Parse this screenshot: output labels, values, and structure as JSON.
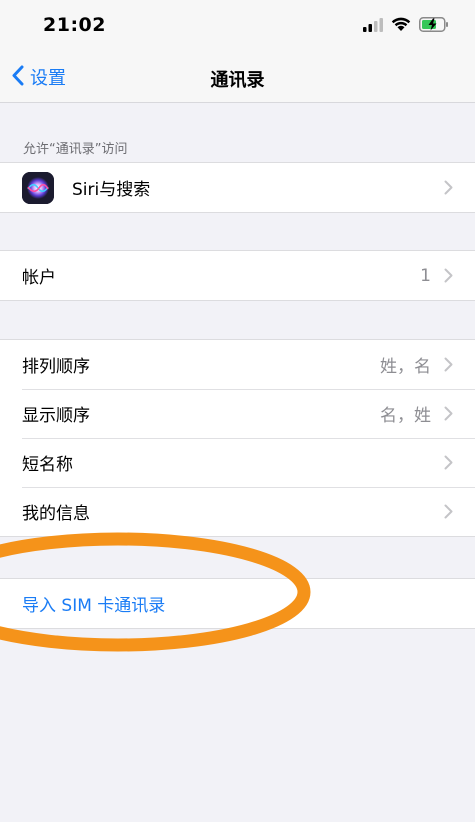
{
  "status_bar": {
    "time": "21:02",
    "battery_color": "#34c759"
  },
  "nav": {
    "back_label": "设置",
    "title": "通讯录"
  },
  "section": {
    "header": "允许“通讯录”访问"
  },
  "groups": {
    "siri": {
      "label": "Siri与搜索"
    },
    "account": {
      "label": "帐户",
      "value": "1"
    },
    "sorting": {
      "rows": [
        {
          "label": "排列顺序",
          "value": "姓，名"
        },
        {
          "label": "显示顺序",
          "value": "名，姓"
        },
        {
          "label": "短名称"
        },
        {
          "label": "我的信息"
        }
      ]
    },
    "import": {
      "label": "导入 SIM 卡通讯录"
    }
  },
  "colors": {
    "accent": "#1a7cf5",
    "annotation": "#f5931a",
    "background": "#f2f2f7"
  },
  "icons": [
    "cellular-signal-icon",
    "wifi-icon",
    "battery-charging-icon",
    "chevron-left-icon",
    "siri-icon",
    "chevron-right-icon"
  ]
}
